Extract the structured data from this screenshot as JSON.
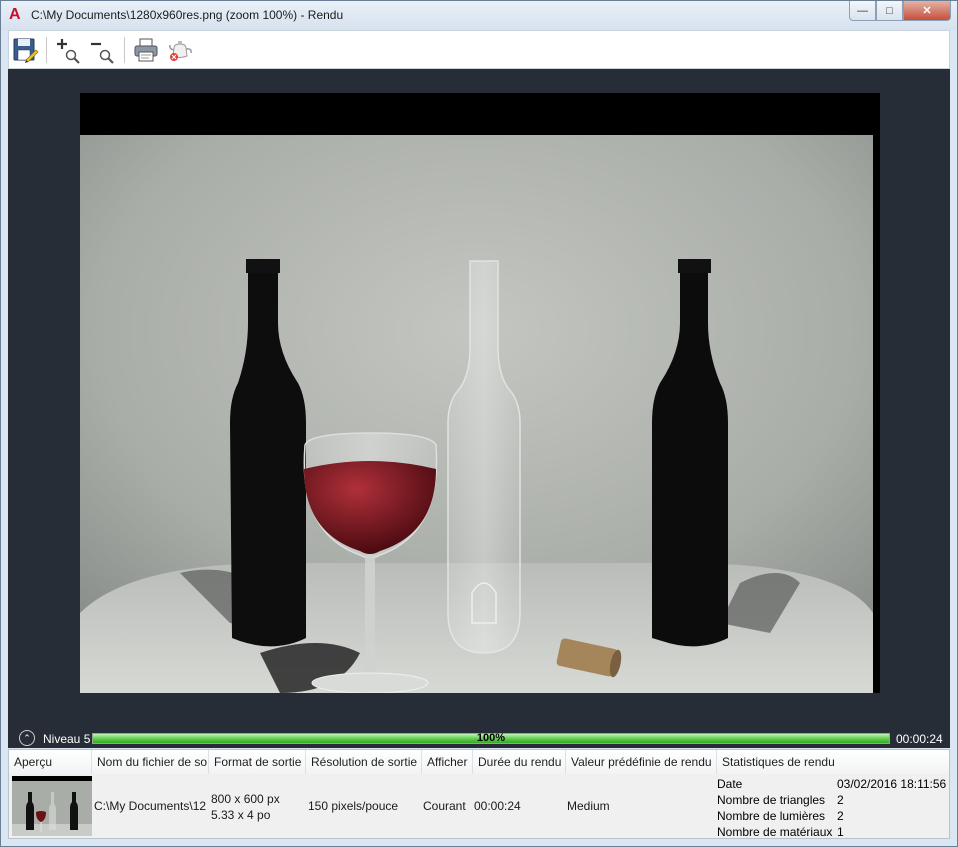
{
  "window": {
    "title": "C:\\My Documents\\1280x960res.png (zoom 100%) - Rendu",
    "app_icon": "A"
  },
  "toolbar": {
    "buttons": [
      {
        "name": "save-button",
        "icon": "floppy-disk-icon"
      },
      {
        "name": "zoom-in-button",
        "icon": "zoom-in-icon"
      },
      {
        "name": "zoom-out-button",
        "icon": "zoom-out-icon"
      },
      {
        "name": "print-button",
        "icon": "printer-icon"
      },
      {
        "name": "cancel-render-button",
        "icon": "teapot-cancel-icon"
      }
    ]
  },
  "progress": {
    "level": "Niveau 5",
    "percent": 100,
    "percent_label": "100%",
    "elapsed": "00:00:24"
  },
  "history": {
    "columns": [
      "Aperçu",
      "Nom du fichier de so",
      "Format de sortie",
      "Résolution de sortie",
      "Afficher",
      "Durée du rendu",
      "Valeur prédéfinie de rendu",
      "Statistiques de rendu"
    ],
    "row": {
      "filename": "C:\\My Documents\\12",
      "format_line1": "800 x 600 px",
      "format_line2": "5.33 x 4 po",
      "resolution": "150 pixels/pouce",
      "display": "Courant",
      "duration": "00:00:24",
      "preset": "Medium",
      "stats": [
        {
          "label": "Date",
          "value": "03/02/2016 18:11:56"
        },
        {
          "label": "Nombre de triangles",
          "value": "2"
        },
        {
          "label": "Nombre de lumières",
          "value": "2"
        },
        {
          "label": "Nombre de matériaux",
          "value": "1"
        }
      ]
    }
  },
  "colors": {
    "canvas_bg": "#262d37",
    "progress_fill": "#53c940",
    "wine": "#6a1018"
  }
}
